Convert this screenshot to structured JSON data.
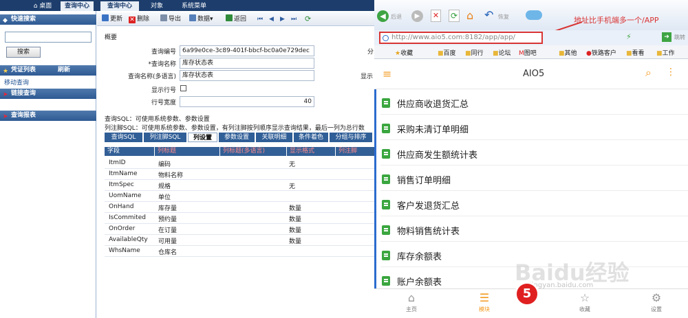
{
  "top_tabs": [
    "桌面",
    "查询中心",
    "对象",
    "系统菜单"
  ],
  "sub_tabs": [
    "查询中心"
  ],
  "sidebar": {
    "quick_search_title": "快速搜索",
    "search_button": "搜索",
    "search_value": "",
    "voucher_title": "凭证列表",
    "refresh_label": "刷新",
    "mobile_query": "移动查询",
    "link_query_title": "链接查询",
    "query_report_title": "查询报表"
  },
  "toolbar": {
    "update": "更新",
    "delete": "删除",
    "export": "导出",
    "data": "数据",
    "back": "返回"
  },
  "section_title": "概要",
  "form": {
    "query_id_label": "查询编号",
    "query_id_value": "6a99e0ce-3c89-401f-bbcf-bc0a0e729dec",
    "query_name_label": "*查询名称",
    "query_name_value": "库存状态表",
    "query_name_ml_label": "查询名称(多语言)",
    "query_name_ml_value": "库存状态表",
    "show_row_no_label": "显示行号",
    "row_width_label": "行号宽度",
    "row_width_value": "40",
    "right_cut_1": "分",
    "right_cut_2": "显示"
  },
  "sql_note": "查询SQL：可使用系统参数、参数设置",
  "footer_note": "列注脚SQL：可使用系统参数、参数设置，有列注脚按列顺序显示查询结果，最后一列为总行数",
  "detail_tabs": [
    "查询SQL",
    "列注脚SQL",
    "列设置",
    "参数设置",
    "关联明细",
    "条件着色",
    "分组与排序"
  ],
  "grid": {
    "headers": [
      "字段",
      "列标题",
      "列标题(多语言)",
      "显示格式",
      "列注脚"
    ],
    "rows": [
      [
        "ItmID",
        "编码",
        "",
        "无"
      ],
      [
        "ItmName",
        "物料名称",
        "",
        ""
      ],
      [
        "ItmSpec",
        "规格",
        "",
        "无"
      ],
      [
        "UomName",
        "单位",
        "",
        ""
      ],
      [
        "OnHand",
        "库存量",
        "",
        "数量"
      ],
      [
        "IsCommited",
        "预约量",
        "",
        "数量"
      ],
      [
        "OnOrder",
        "在订量",
        "",
        "数量"
      ],
      [
        "AvailableQty",
        "可用量",
        "",
        "数量"
      ],
      [
        "WhsName",
        "仓库名",
        "",
        ""
      ]
    ]
  },
  "browser": {
    "back_label": "后退",
    "restore_label": "恢复",
    "annotation": "地址比手机端多一个/APP",
    "url": "http://www.aio5.com:8182/app/app/",
    "goto_label": "跳转",
    "bookmarks": [
      "收藏",
      "百度",
      "同行",
      "论坛",
      "图吧",
      "其他",
      "铁路客户",
      "看看",
      "工作"
    ],
    "app_title": "AIO5",
    "menu_items": [
      "供应商收退货汇总",
      "采购未清订单明细",
      "供应商发生额统计表",
      "销售订单明细",
      "客户发退货汇总",
      "物料销售统计表",
      "库存余额表",
      "账户余额表"
    ],
    "bottom_nav": [
      "主页",
      "模块",
      "收藏",
      "设置"
    ],
    "watermark": "Baidu经验",
    "watermark_sub": "jingyan.baidu.com"
  },
  "colors": {
    "nav_blue": "#1d3e6d",
    "tab_blue": "#305e97",
    "accent_orange": "#f39a1f",
    "annotation_red": "#d93434",
    "doc_green": "#3aa63f"
  }
}
